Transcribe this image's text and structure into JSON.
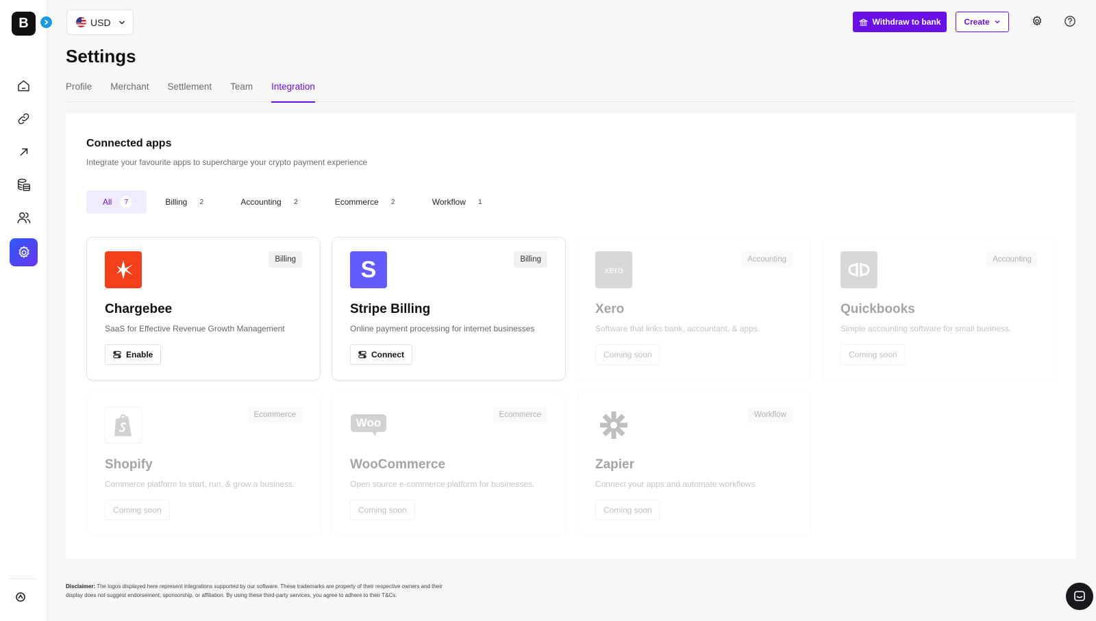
{
  "brand": {
    "logo_letter": "B"
  },
  "sidebar": {
    "items": [
      {
        "name": "home-icon"
      },
      {
        "name": "link-icon"
      },
      {
        "name": "arrow-up-right-icon"
      },
      {
        "name": "coins-icon"
      },
      {
        "name": "users-icon"
      },
      {
        "name": "settings-icon",
        "active": true
      }
    ]
  },
  "topbar": {
    "currency": "USD",
    "withdraw_label": "Withdraw to bank",
    "create_label": "Create"
  },
  "page": {
    "title": "Settings",
    "tabs": [
      {
        "label": "Profile"
      },
      {
        "label": "Merchant"
      },
      {
        "label": "Settlement"
      },
      {
        "label": "Team"
      },
      {
        "label": "Integration",
        "active": true
      }
    ]
  },
  "section": {
    "title": "Connected apps",
    "subtitle": "Integrate your favourite apps to supercharge your crypto payment experience"
  },
  "filters": [
    {
      "label": "All",
      "count": "7",
      "active": true
    },
    {
      "label": "Billing",
      "count": "2"
    },
    {
      "label": "Accounting",
      "count": "2"
    },
    {
      "label": "Ecommerce",
      "count": "2"
    },
    {
      "label": "Workflow",
      "count": "1"
    }
  ],
  "apps": [
    {
      "name": "Chargebee",
      "tag": "Billing",
      "description": "SaaS for Effective Revenue Growth Management",
      "action": "Enable",
      "logo_color": "#f4401a",
      "status": "available"
    },
    {
      "name": "Stripe Billing",
      "tag": "Billing",
      "description": "Online payment processing for internet businesses",
      "action": "Connect",
      "logo_color": "#635bff",
      "status": "available"
    },
    {
      "name": "Xero",
      "tag": "Accounting",
      "description": "Software that links bank, accountant, & apps.",
      "action": "Coming soon",
      "logo_color": "#9a9a9a",
      "status": "coming-soon"
    },
    {
      "name": "Quickbooks",
      "tag": "Accounting",
      "description": "Simple accounting software for small business.",
      "action": "Coming soon",
      "logo_color": "#9a9a9a",
      "status": "coming-soon"
    },
    {
      "name": "Shopify",
      "tag": "Ecommerce",
      "description": "Commerce platform to start, run, & grow a business.",
      "action": "Coming soon",
      "logo_color": "#9a9a9a",
      "status": "coming-soon"
    },
    {
      "name": "WooCommerce",
      "tag": "Ecommerce",
      "description": "Open source e-commerce platform for businesses.",
      "action": "Coming soon",
      "logo_color": "#9a9a9a",
      "status": "coming-soon"
    },
    {
      "name": "Zapier",
      "tag": "Workflow",
      "description": "Connect your apps and automate workflows",
      "action": "Coming soon",
      "logo_color": "#9a9a9a",
      "status": "coming-soon"
    }
  ],
  "xero_logo_text": "xero",
  "woo_logo_text": "Woo",
  "disclaimer": {
    "label": "Disclaimer:",
    "text": "The logos displayed here represent integrations supported by our software. These trademarks are property of their respective owners and their display does not suggest endorsement, sponsorship, or affiliation. By using these third-party services, you agree to adhere to their T&Cs."
  },
  "colors": {
    "accent": "#6a0fe6",
    "active_nav_start": "#2c5bf5",
    "active_nav_end": "#6b35f0"
  }
}
